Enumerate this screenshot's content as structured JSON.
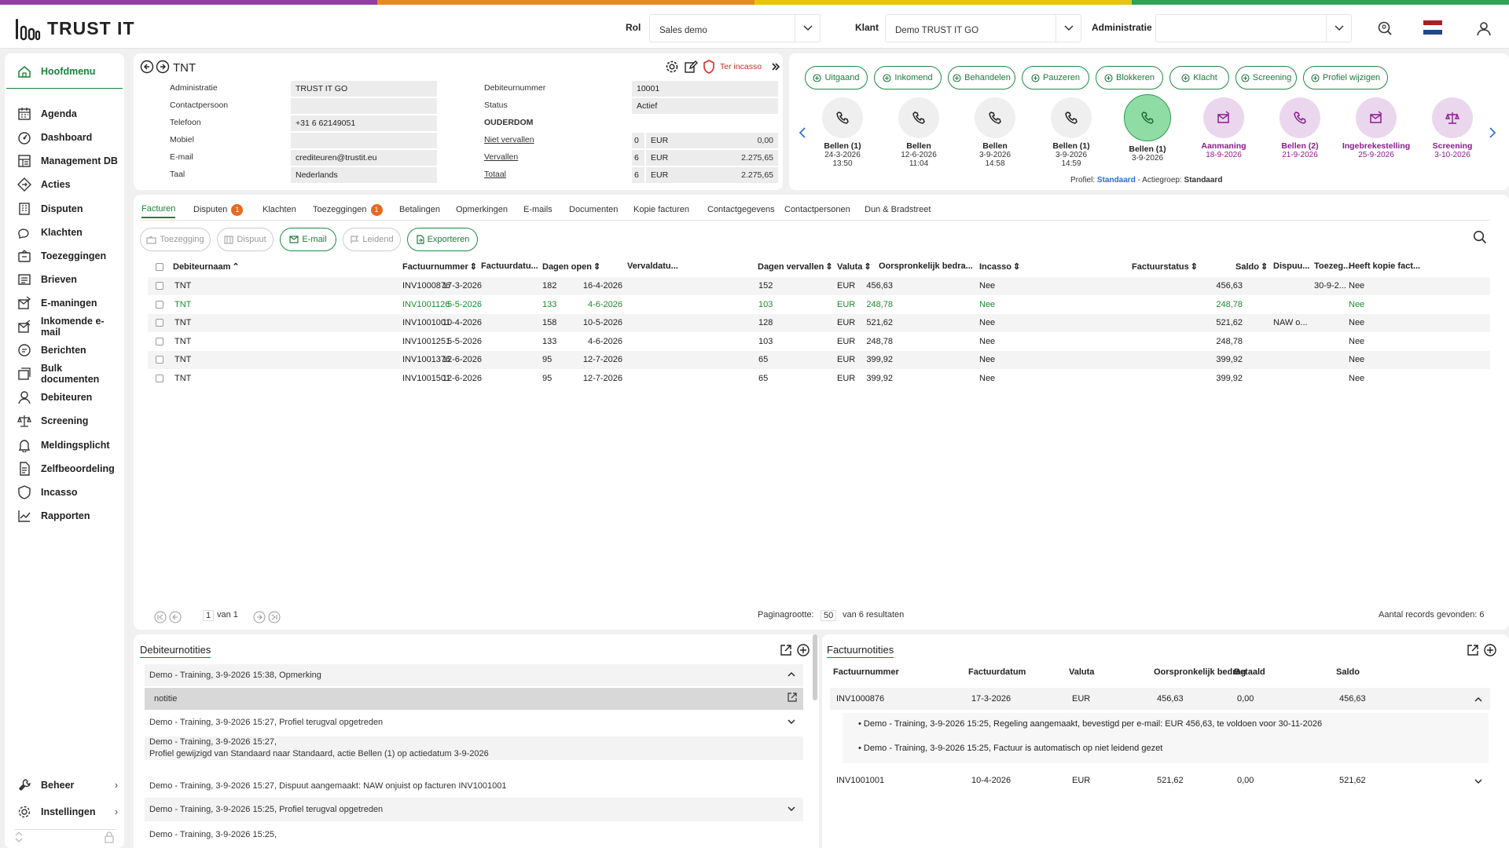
{
  "brand": {
    "name": "TRUST IT",
    "strip_colors": [
      "#8e3fa0",
      "#e98a1e",
      "#e6c40c",
      "#2ea454"
    ]
  },
  "header": {
    "rol_label": "Rol",
    "rol_value": "Sales demo",
    "klant_label": "Klant",
    "klant_value": "Demo TRUST IT GO",
    "admin_label": "Administratie",
    "admin_value": ""
  },
  "sidebar": {
    "items": [
      "Hoofdmenu",
      "Agenda",
      "Dashboard",
      "Management DB",
      "Acties",
      "Disputen",
      "Klachten",
      "Toezeggingen",
      "Brieven",
      "E-maningen",
      "Inkomende e-mail",
      "Berichten",
      "Bulk documenten",
      "Debiteuren",
      "Screening",
      "Meldingsplicht",
      "Zelfbeoordeling",
      "Incasso",
      "Rapporten"
    ],
    "bottom": [
      "Beheer",
      "Instellingen"
    ]
  },
  "debtor": {
    "name": "TNT",
    "ter_incasso": "Ter incasso",
    "left_fields": [
      {
        "label": "Administratie",
        "value": "TRUST IT GO"
      },
      {
        "label": "Contactpersoon",
        "value": ""
      },
      {
        "label": "Telefoon",
        "value": "+31 6 62149051"
      },
      {
        "label": "Mobiel",
        "value": ""
      },
      {
        "label": "E-mail",
        "value": "crediteuren@trustit.eu"
      },
      {
        "label": "Taal",
        "value": "Nederlands"
      }
    ],
    "debiteurnummer_label": "Debiteurnummer",
    "debiteurnummer": "10001",
    "status_label": "Status",
    "status": "Actief",
    "age_label": "OUDERDOM",
    "amounts": [
      {
        "label": "Niet vervallen",
        "count": "0",
        "currency": "EUR",
        "amount": "0,00"
      },
      {
        "label": "Vervallen",
        "count": "6",
        "currency": "EUR",
        "amount": "2.275,65"
      },
      {
        "label": "Totaal",
        "count": "6",
        "currency": "EUR",
        "amount": "2.275,65"
      }
    ]
  },
  "actions": [
    "Uitgaand",
    "Inkomend",
    "Behandelen",
    "Pauzeren",
    "Blokkeren",
    "Klacht",
    "Screening",
    "Profiel wijzigen"
  ],
  "timeline": [
    {
      "l1": "Bellen (1)",
      "l2": "24-3-2026",
      "l3": "13:50",
      "icon": "phone",
      "style": "grey"
    },
    {
      "l1": "Bellen",
      "l2": "12-6-2026",
      "l3": "11:04",
      "icon": "phone",
      "style": "grey"
    },
    {
      "l1": "Bellen",
      "l2": "3-9-2026",
      "l3": "14:58",
      "icon": "phone",
      "style": "grey"
    },
    {
      "l1": "Bellen (1)",
      "l2": "3-9-2026",
      "l3": "14:59",
      "icon": "phone",
      "style": "grey"
    },
    {
      "l1": "Bellen (1)",
      "l2": "3-9-2026",
      "l3": "",
      "icon": "phone",
      "style": "active"
    },
    {
      "l1": "Aanmaning",
      "l2": "18-9-2026",
      "l3": "",
      "icon": "mail",
      "style": "purple"
    },
    {
      "l1": "Bellen (2)",
      "l2": "21-9-2026",
      "l3": "",
      "icon": "phone",
      "style": "purple"
    },
    {
      "l1": "Ingebrekestelling",
      "l2": "25-9-2026",
      "l3": "",
      "icon": "mail",
      "style": "purple"
    },
    {
      "l1": "Screening",
      "l2": "3-10-2026",
      "l3": "",
      "icon": "scale",
      "style": "purple"
    }
  ],
  "profile": {
    "profiel_label": "Profiel:",
    "profiel": "Standaard",
    "actiegroep_label": "- Actiegroep:",
    "actiegroep": "Standaard"
  },
  "tabs": [
    {
      "label": "Facturen",
      "badge": ""
    },
    {
      "label": "Disputen",
      "badge": "1"
    },
    {
      "label": "Klachten",
      "badge": ""
    },
    {
      "label": "Toezeggingen",
      "badge": "1"
    },
    {
      "label": "Betalingen",
      "badge": ""
    },
    {
      "label": "Opmerkingen",
      "badge": ""
    },
    {
      "label": "E-mails",
      "badge": ""
    },
    {
      "label": "Documenten",
      "badge": ""
    },
    {
      "label": "Kopie facturen",
      "badge": ""
    },
    {
      "label": "Contactgegevens",
      "badge": ""
    },
    {
      "label": "Contactpersonen",
      "badge": ""
    },
    {
      "label": "Dun & Bradstreet",
      "badge": ""
    }
  ],
  "toolbar": {
    "toezegging": "Toezegging",
    "dispuut": "Dispuut",
    "email": "E-mail",
    "leidend": "Leidend",
    "exporteren": "Exporteren"
  },
  "table": {
    "columns": [
      "Debiteurnaam",
      "Factuurnummer",
      "Factuurdatu...",
      "Dagen open",
      "Vervaldatu...",
      "Dagen vervallen",
      "Valuta",
      "Oorspronkelijk bedra...",
      "Incasso",
      "Factuurstatus",
      "Saldo",
      "Dispuu...",
      "Toezeg...",
      "Heeft kopie fact..."
    ],
    "rows": [
      [
        "TNT",
        "INV1000876",
        "17-3-2026",
        "182",
        "16-4-2026",
        "152",
        "EUR",
        "456,63",
        "Nee",
        "",
        "456,63",
        "",
        "30-9-2...",
        "Nee"
      ],
      [
        "TNT",
        "INV1001126",
        "5-5-2026",
        "133",
        "4-6-2026",
        "103",
        "EUR",
        "248,78",
        "Nee",
        "",
        "248,78",
        "",
        "",
        "Nee"
      ],
      [
        "TNT",
        "INV1001001",
        "10-4-2026",
        "158",
        "10-5-2026",
        "128",
        "EUR",
        "521,62",
        "Nee",
        "",
        "521,62",
        "NAW o...",
        "",
        "Nee"
      ],
      [
        "TNT",
        "INV1001251",
        "5-5-2026",
        "133",
        "4-6-2026",
        "103",
        "EUR",
        "248,78",
        "Nee",
        "",
        "248,78",
        "",
        "",
        "Nee"
      ],
      [
        "TNT",
        "INV1001376",
        "12-6-2026",
        "95",
        "12-7-2026",
        "65",
        "EUR",
        "399,92",
        "Nee",
        "",
        "399,92",
        "",
        "",
        "Nee"
      ],
      [
        "TNT",
        "INV1001501",
        "12-6-2026",
        "95",
        "12-7-2026",
        "65",
        "EUR",
        "399,92",
        "Nee",
        "",
        "399,92",
        "",
        "",
        "Nee"
      ]
    ]
  },
  "pagination": {
    "page": "1",
    "of": "van 1",
    "size_label": "Paginagrootte:",
    "size": "50",
    "results": "van 6 resultaten",
    "found": "Aantal records gevonden: 6"
  },
  "debtor_notes": {
    "title": "Debiteurnotities",
    "items": [
      {
        "text": "Demo - Training, 3-9-2026 15:38, Opmerking"
      },
      {
        "text": "notitie"
      },
      {
        "text": "Demo - Training, 3-9-2026 15:27, Profiel terugval opgetreden"
      },
      {
        "text": "Demo - Training, 3-9-2026 15:27,"
      },
      {
        "text": "Profiel gewijzigd van Standaard naar Standaard, actie Bellen (1) op actiedatum 3-9-2026"
      },
      {
        "text": "Demo - Training, 3-9-2026 15:27, Dispuut aangemaakt: NAW onjuist op facturen INV1001001"
      },
      {
        "text": "Demo - Training, 3-9-2026 15:25, Profiel terugval opgetreden"
      },
      {
        "text": "Demo - Training, 3-9-2026 15:25,"
      }
    ]
  },
  "invoice_notes": {
    "title": "Factuurnotities",
    "columns": [
      "Factuurnummer",
      "Factuurdatum",
      "Valuta",
      "Oorspronkelijk bedrag",
      "Betaald",
      "Saldo"
    ],
    "rows": [
      [
        "INV1000876",
        "17-3-2026",
        "EUR",
        "456,63",
        "0,00",
        "456,63"
      ],
      [
        "INV1001001",
        "10-4-2026",
        "EUR",
        "521,62",
        "0,00",
        "521,62"
      ]
    ],
    "sub": [
      "Demo - Training, 3-9-2026 15:25, Regeling aangemaakt, bevestigd per e-mail: EUR 456,63, te voldoen voor 30-11-2026",
      "Demo - Training, 3-9-2026 15:25, Factuur is automatisch op niet leidend gezet"
    ]
  }
}
